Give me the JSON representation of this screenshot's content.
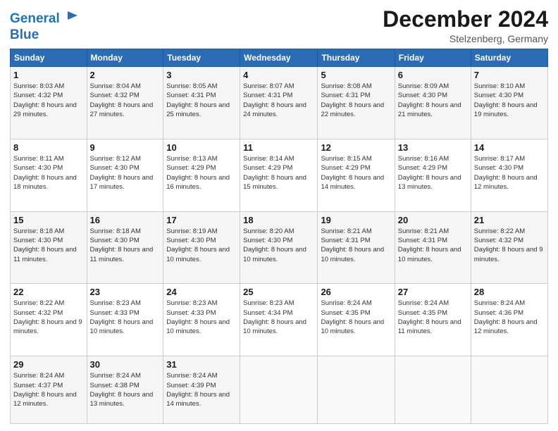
{
  "header": {
    "logo_line1": "General",
    "logo_line2": "Blue",
    "month": "December 2024",
    "location": "Stelzenberg, Germany"
  },
  "days_of_week": [
    "Sunday",
    "Monday",
    "Tuesday",
    "Wednesday",
    "Thursday",
    "Friday",
    "Saturday"
  ],
  "weeks": [
    [
      {
        "day": 1,
        "rise": "8:03 AM",
        "set": "4:32 PM",
        "daylight": "8 hours and 29 minutes."
      },
      {
        "day": 2,
        "rise": "8:04 AM",
        "set": "4:32 PM",
        "daylight": "8 hours and 27 minutes."
      },
      {
        "day": 3,
        "rise": "8:05 AM",
        "set": "4:31 PM",
        "daylight": "8 hours and 25 minutes."
      },
      {
        "day": 4,
        "rise": "8:07 AM",
        "set": "4:31 PM",
        "daylight": "8 hours and 24 minutes."
      },
      {
        "day": 5,
        "rise": "8:08 AM",
        "set": "4:31 PM",
        "daylight": "8 hours and 22 minutes."
      },
      {
        "day": 6,
        "rise": "8:09 AM",
        "set": "4:30 PM",
        "daylight": "8 hours and 21 minutes."
      },
      {
        "day": 7,
        "rise": "8:10 AM",
        "set": "4:30 PM",
        "daylight": "8 hours and 19 minutes."
      }
    ],
    [
      {
        "day": 8,
        "rise": "8:11 AM",
        "set": "4:30 PM",
        "daylight": "8 hours and 18 minutes."
      },
      {
        "day": 9,
        "rise": "8:12 AM",
        "set": "4:30 PM",
        "daylight": "8 hours and 17 minutes."
      },
      {
        "day": 10,
        "rise": "8:13 AM",
        "set": "4:29 PM",
        "daylight": "8 hours and 16 minutes."
      },
      {
        "day": 11,
        "rise": "8:14 AM",
        "set": "4:29 PM",
        "daylight": "8 hours and 15 minutes."
      },
      {
        "day": 12,
        "rise": "8:15 AM",
        "set": "4:29 PM",
        "daylight": "8 hours and 14 minutes."
      },
      {
        "day": 13,
        "rise": "8:16 AM",
        "set": "4:29 PM",
        "daylight": "8 hours and 13 minutes."
      },
      {
        "day": 14,
        "rise": "8:17 AM",
        "set": "4:30 PM",
        "daylight": "8 hours and 12 minutes."
      }
    ],
    [
      {
        "day": 15,
        "rise": "8:18 AM",
        "set": "4:30 PM",
        "daylight": "8 hours and 11 minutes."
      },
      {
        "day": 16,
        "rise": "8:18 AM",
        "set": "4:30 PM",
        "daylight": "8 hours and 11 minutes."
      },
      {
        "day": 17,
        "rise": "8:19 AM",
        "set": "4:30 PM",
        "daylight": "8 hours and 10 minutes."
      },
      {
        "day": 18,
        "rise": "8:20 AM",
        "set": "4:30 PM",
        "daylight": "8 hours and 10 minutes."
      },
      {
        "day": 19,
        "rise": "8:21 AM",
        "set": "4:31 PM",
        "daylight": "8 hours and 10 minutes."
      },
      {
        "day": 20,
        "rise": "8:21 AM",
        "set": "4:31 PM",
        "daylight": "8 hours and 10 minutes."
      },
      {
        "day": 21,
        "rise": "8:22 AM",
        "set": "4:32 PM",
        "daylight": "8 hours and 9 minutes."
      }
    ],
    [
      {
        "day": 22,
        "rise": "8:22 AM",
        "set": "4:32 PM",
        "daylight": "8 hours and 9 minutes."
      },
      {
        "day": 23,
        "rise": "8:23 AM",
        "set": "4:33 PM",
        "daylight": "8 hours and 10 minutes."
      },
      {
        "day": 24,
        "rise": "8:23 AM",
        "set": "4:33 PM",
        "daylight": "8 hours and 10 minutes."
      },
      {
        "day": 25,
        "rise": "8:23 AM",
        "set": "4:34 PM",
        "daylight": "8 hours and 10 minutes."
      },
      {
        "day": 26,
        "rise": "8:24 AM",
        "set": "4:35 PM",
        "daylight": "8 hours and 10 minutes."
      },
      {
        "day": 27,
        "rise": "8:24 AM",
        "set": "4:35 PM",
        "daylight": "8 hours and 11 minutes."
      },
      {
        "day": 28,
        "rise": "8:24 AM",
        "set": "4:36 PM",
        "daylight": "8 hours and 12 minutes."
      }
    ],
    [
      {
        "day": 29,
        "rise": "8:24 AM",
        "set": "4:37 PM",
        "daylight": "8 hours and 12 minutes."
      },
      {
        "day": 30,
        "rise": "8:24 AM",
        "set": "4:38 PM",
        "daylight": "8 hours and 13 minutes."
      },
      {
        "day": 31,
        "rise": "8:24 AM",
        "set": "4:39 PM",
        "daylight": "8 hours and 14 minutes."
      },
      null,
      null,
      null,
      null
    ]
  ]
}
